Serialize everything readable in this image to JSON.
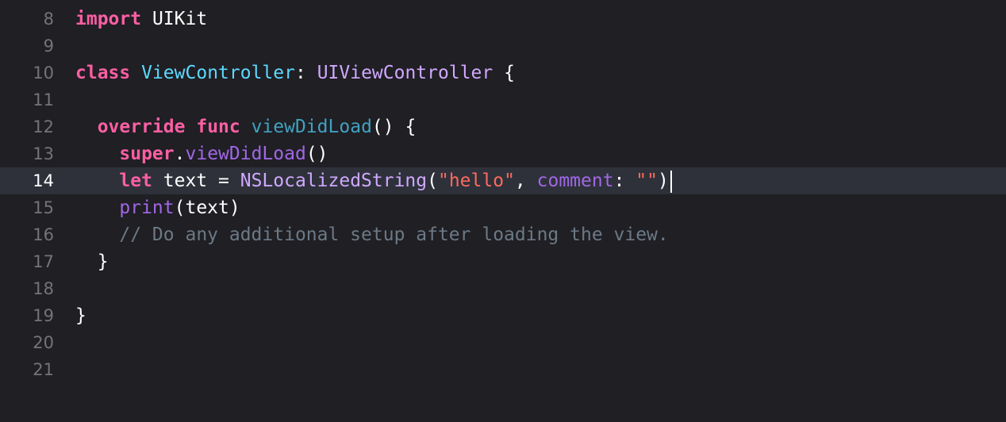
{
  "editor": {
    "current_line": "14",
    "lines": [
      {
        "number": "8",
        "tokens": [
          {
            "t": "import",
            "c": "kw"
          },
          {
            "t": " UIKit",
            "c": "plain"
          }
        ]
      },
      {
        "number": "9",
        "tokens": []
      },
      {
        "number": "10",
        "tokens": [
          {
            "t": "class",
            "c": "kw"
          },
          {
            "t": " ",
            "c": "plain"
          },
          {
            "t": "ViewController",
            "c": "type-decl"
          },
          {
            "t": ": ",
            "c": "plain"
          },
          {
            "t": "UIViewController",
            "c": "type-ref"
          },
          {
            "t": " {",
            "c": "plain"
          }
        ]
      },
      {
        "number": "11",
        "tokens": []
      },
      {
        "number": "12",
        "tokens": [
          {
            "t": "  ",
            "c": "plain"
          },
          {
            "t": "override",
            "c": "kw"
          },
          {
            "t": " ",
            "c": "plain"
          },
          {
            "t": "func",
            "c": "kw"
          },
          {
            "t": " ",
            "c": "plain"
          },
          {
            "t": "viewDidLoad",
            "c": "fn-decl"
          },
          {
            "t": "() {",
            "c": "plain"
          }
        ]
      },
      {
        "number": "13",
        "tokens": [
          {
            "t": "    ",
            "c": "plain"
          },
          {
            "t": "super",
            "c": "kw"
          },
          {
            "t": ".",
            "c": "plain"
          },
          {
            "t": "viewDidLoad",
            "c": "fn-ref"
          },
          {
            "t": "()",
            "c": "plain"
          }
        ]
      },
      {
        "number": "14",
        "tokens": [
          {
            "t": "    ",
            "c": "plain"
          },
          {
            "t": "let",
            "c": "kw"
          },
          {
            "t": " text = ",
            "c": "plain"
          },
          {
            "t": "NSLocalizedString",
            "c": "lib"
          },
          {
            "t": "(",
            "c": "plain"
          },
          {
            "t": "\"hello\"",
            "c": "str"
          },
          {
            "t": ", ",
            "c": "plain"
          },
          {
            "t": "comment",
            "c": "param"
          },
          {
            "t": ": ",
            "c": "plain"
          },
          {
            "t": "\"\"",
            "c": "str"
          },
          {
            "t": ")",
            "c": "plain"
          }
        ],
        "caret": true
      },
      {
        "number": "15",
        "tokens": [
          {
            "t": "    ",
            "c": "plain"
          },
          {
            "t": "print",
            "c": "fn-ref"
          },
          {
            "t": "(text)",
            "c": "plain"
          }
        ]
      },
      {
        "number": "16",
        "tokens": [
          {
            "t": "    ",
            "c": "plain"
          },
          {
            "t": "// Do any additional setup after loading the view.",
            "c": "cmt"
          }
        ]
      },
      {
        "number": "17",
        "tokens": [
          {
            "t": "  }",
            "c": "plain"
          }
        ]
      },
      {
        "number": "18",
        "tokens": []
      },
      {
        "number": "19",
        "tokens": [
          {
            "t": "}",
            "c": "plain"
          }
        ]
      },
      {
        "number": "20",
        "tokens": []
      },
      {
        "number": "21",
        "tokens": []
      }
    ]
  },
  "colors": {
    "background": "#1f1f24",
    "current_line_highlight": "#2e313a",
    "keyword": "#fc5fa3",
    "type_declaration": "#5dd8ff",
    "string": "#fc6a5d",
    "comment": "#6c7986"
  }
}
